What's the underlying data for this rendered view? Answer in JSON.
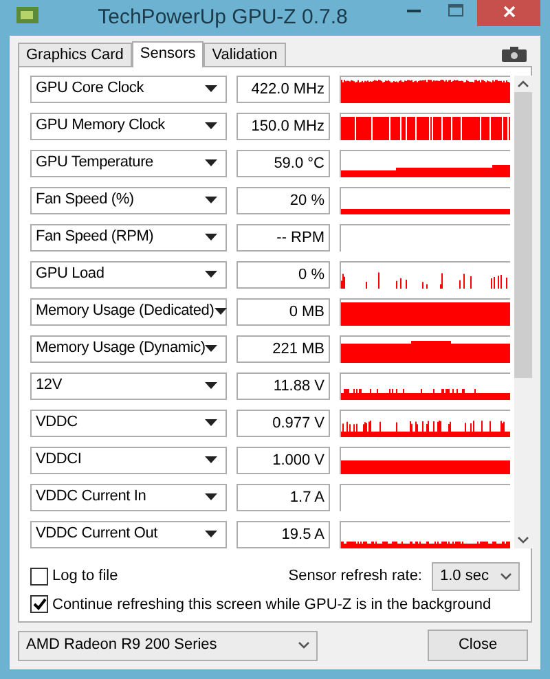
{
  "window": {
    "title": "TechPowerUp GPU-Z 0.7.8"
  },
  "tabs": [
    {
      "label": "Graphics Card",
      "selected": false
    },
    {
      "label": "Sensors",
      "selected": true
    },
    {
      "label": "Validation",
      "selected": false
    }
  ],
  "sensors": [
    {
      "name": "GPU Core Clock",
      "value": "422.0 MHz"
    },
    {
      "name": "GPU Memory Clock",
      "value": "150.0 MHz"
    },
    {
      "name": "GPU Temperature",
      "value": "59.0 °C"
    },
    {
      "name": "Fan Speed (%)",
      "value": "20 %"
    },
    {
      "name": "Fan Speed (RPM)",
      "value": "-- RPM"
    },
    {
      "name": "GPU Load",
      "value": "0 %"
    },
    {
      "name": "Memory Usage (Dedicated)",
      "value": "0 MB"
    },
    {
      "name": "Memory Usage (Dynamic)",
      "value": "221 MB"
    },
    {
      "name": "12V",
      "value": "11.88 V"
    },
    {
      "name": "VDDC",
      "value": "0.977 V"
    },
    {
      "name": "VDDCI",
      "value": "1.000 V"
    },
    {
      "name": "VDDC Current In",
      "value": "1.7 A"
    },
    {
      "name": "VDDC Current Out",
      "value": "19.5 A"
    }
  ],
  "log_to_file": {
    "label": "Log to file",
    "checked": false
  },
  "refresh_rate": {
    "label": "Sensor refresh rate:",
    "value": "1.0 sec"
  },
  "continue_refreshing": {
    "label": "Continue refreshing this screen while GPU-Z is in the background",
    "checked": true
  },
  "device_select": {
    "value": "AMD Radeon R9 200 Series"
  },
  "close_button": {
    "label": "Close"
  }
}
